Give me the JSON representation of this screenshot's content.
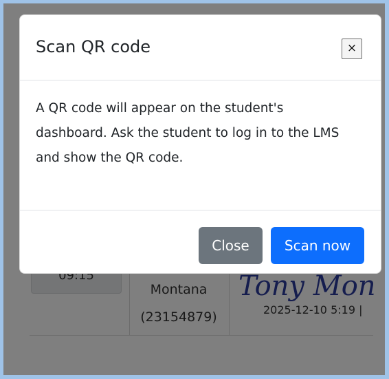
{
  "background": {
    "time_chip": "09:15",
    "student": {
      "name": "Montana",
      "id": "(23154879)"
    },
    "signature": {
      "text": "Tony Mon",
      "timestamp": "2025-12-10 5:19 |"
    }
  },
  "modal": {
    "title": "Scan QR code",
    "close_icon": "×",
    "body": "A QR code will appear on the student's dashboard. Ask the student to log in to the LMS and show the QR code.",
    "buttons": {
      "close": "Close",
      "scan": "Scan now"
    }
  },
  "colors": {
    "primary": "#0d6efd",
    "secondary": "#6c757d",
    "frame": "#9fc3e8"
  }
}
